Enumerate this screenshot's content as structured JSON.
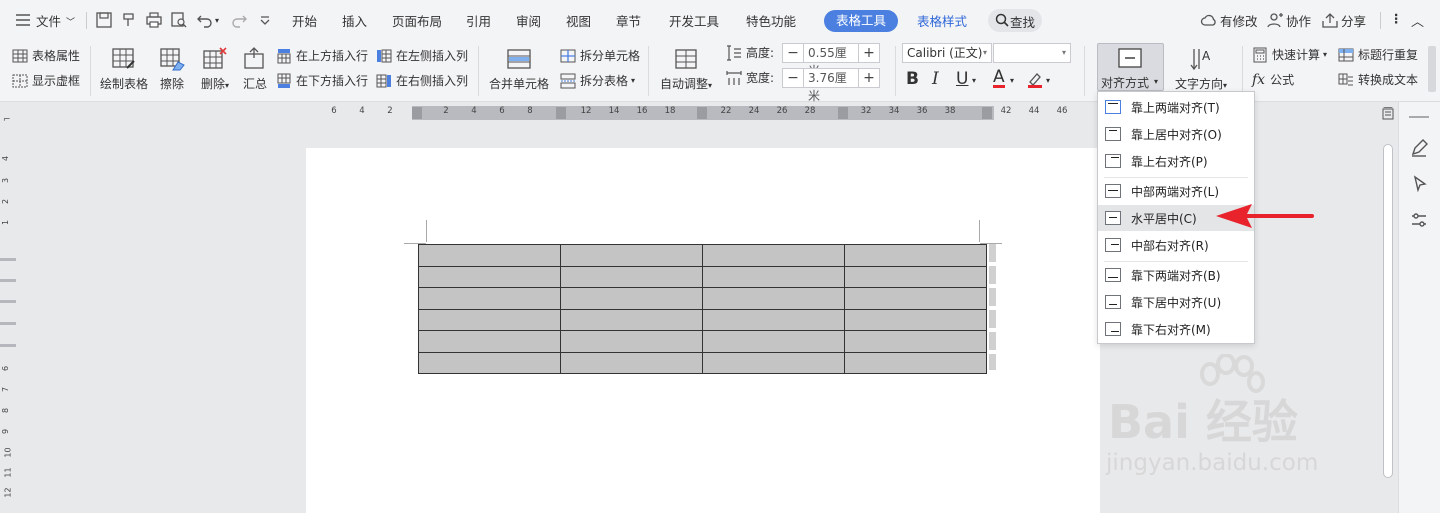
{
  "menubar": {
    "file_label": "文件",
    "tabs": [
      "开始",
      "插入",
      "页面布局",
      "引用",
      "审阅",
      "视图",
      "章节",
      "开发工具",
      "特色功能"
    ],
    "table_tools_label": "表格工具",
    "table_style_label": "表格样式",
    "search_label": "查找",
    "modify_label": "有修改",
    "collab_label": "协作",
    "share_label": "分享"
  },
  "ribbon": {
    "table_props": "表格属性",
    "show_grid": "显示虚框",
    "draw_table": "绘制表格",
    "erase": "擦除",
    "delete": "删除",
    "summary": "汇总",
    "insert_row_above": "在上方插入行",
    "insert_row_below": "在下方插入行",
    "insert_col_left": "在左侧插入列",
    "insert_col_right": "在右侧插入列",
    "merge_cells": "合并单元格",
    "split_cells": "拆分单元格",
    "split_table": "拆分表格",
    "auto_fit": "自动调整",
    "height_label": "高度:",
    "height_value": "0.55厘米",
    "width_label": "宽度:",
    "width_value": "3.76厘米",
    "font_name": "Calibri (正文)",
    "font_size": "",
    "align_label": "对齐方式",
    "text_dir_label": "文字方向",
    "quick_calc": "快速计算",
    "repeat_header": "标题行重复",
    "formula": "公式",
    "convert_text": "转换成文本"
  },
  "ruler": {
    "numbers": [
      "6",
      "4",
      "2",
      "2",
      "4",
      "6",
      "8",
      "12",
      "14",
      "16",
      "18",
      "22",
      "24",
      "26",
      "28",
      "32",
      "34",
      "36",
      "38",
      "42",
      "44",
      "46"
    ],
    "vertical_numbers": [
      "4",
      "3",
      "2",
      "1",
      "6",
      "7",
      "8",
      "9",
      "10",
      "11",
      "12"
    ]
  },
  "table": {
    "rows": 6,
    "cols": 4
  },
  "dropdown": {
    "items": [
      "靠上两端对齐(T)",
      "靠上居中对齐(O)",
      "靠上右对齐(P)",
      "中部两端对齐(L)",
      "水平居中(C)",
      "中部右对齐(R)",
      "靠下两端对齐(B)",
      "靠下居中对齐(U)",
      "靠下右对齐(M)"
    ],
    "highlighted_index": 4
  },
  "watermark": {
    "logo_text": "Bai 经验",
    "url": "jingyan.baidu.com"
  },
  "colors": {
    "accent": "#4b80e0",
    "arrow": "#e8232b",
    "table_fill": "#c4c4c4"
  }
}
